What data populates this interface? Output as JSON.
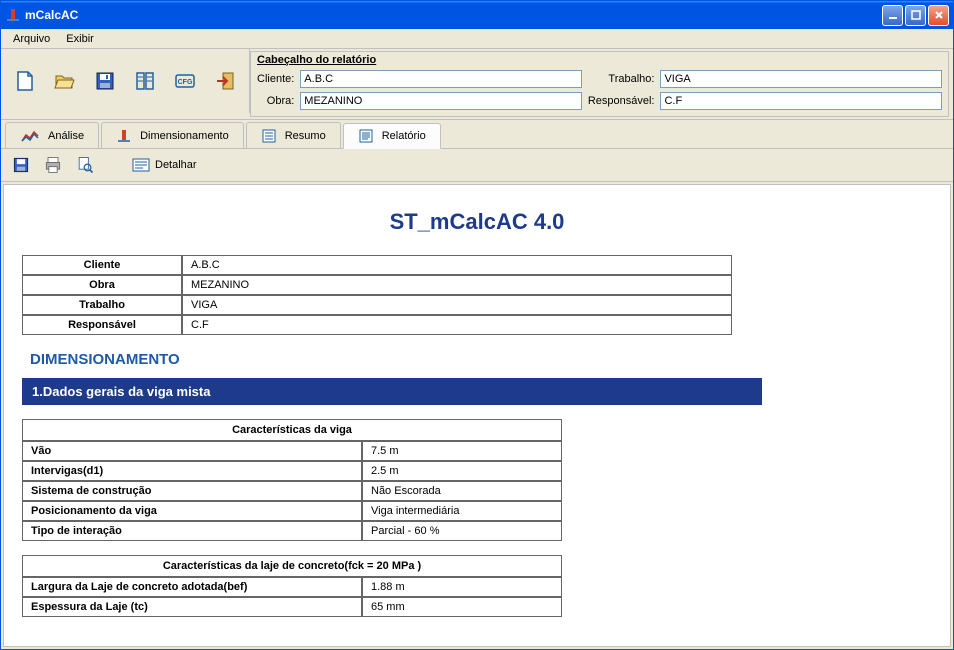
{
  "window": {
    "title": "mCalcAC"
  },
  "menu": {
    "arquivo": "Arquivo",
    "exibir": "Exibir"
  },
  "header": {
    "title": "Cabeçalho do relatório",
    "labels": {
      "cliente": "Cliente:",
      "obra": "Obra:",
      "trabalho": "Trabalho:",
      "responsavel": "Responsável:"
    },
    "values": {
      "cliente": "A.B.C",
      "obra": "MEZANINO",
      "trabalho": "VIGA",
      "responsavel": "C.F"
    }
  },
  "tabs": {
    "analise": "Análise",
    "dimensionamento": "Dimensionamento",
    "resumo": "Resumo",
    "relatorio": "Relatório"
  },
  "subtoolbar": {
    "detalhar": "Detalhar"
  },
  "report": {
    "title": "ST_mCalcAC 4.0",
    "info": [
      {
        "label": "Cliente",
        "value": "A.B.C"
      },
      {
        "label": "Obra",
        "value": "MEZANINO"
      },
      {
        "label": "Trabalho",
        "value": "VIGA"
      },
      {
        "label": "Responsável",
        "value": "C.F"
      }
    ],
    "section_dim": "DIMENSIONAMENTO",
    "section_1": "1.Dados gerais da viga mista",
    "table1": {
      "heading": "Características da viga",
      "rows": [
        {
          "label": "Vão",
          "value": "7.5 m"
        },
        {
          "label": "Intervigas(d1)",
          "value": "2.5 m"
        },
        {
          "label": "Sistema de construção",
          "value": "Não Escorada"
        },
        {
          "label": "Posicionamento da viga",
          "value": "Viga intermediária"
        },
        {
          "label": "Tipo de interação",
          "value": "Parcial - 60 %"
        }
      ]
    },
    "table2": {
      "heading": "Características da laje de concreto(fck = 20 MPa )",
      "rows": [
        {
          "label": "Largura da Laje de concreto adotada(bef)",
          "value": "1.88 m"
        },
        {
          "label": "Espessura da Laje (tc)",
          "value": "65 mm"
        }
      ]
    }
  }
}
